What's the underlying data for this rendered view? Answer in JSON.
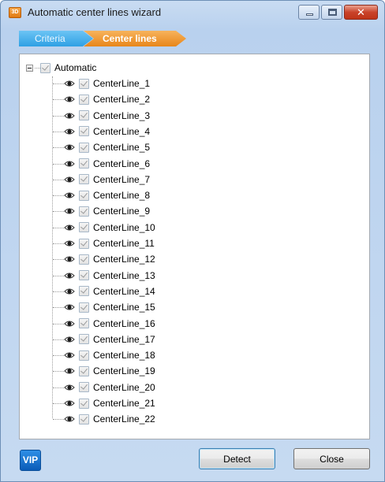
{
  "window": {
    "title": "Automatic center lines wizard",
    "app_icon_text": "3D"
  },
  "breadcrumb": {
    "steps": [
      "Criteria",
      "Center lines"
    ],
    "active_step": "Center lines"
  },
  "tree": {
    "root": {
      "label": "Automatic",
      "checked": true,
      "expanded": true
    },
    "items": [
      "CenterLine_1",
      "CenterLine_2",
      "CenterLine_3",
      "CenterLine_4",
      "CenterLine_5",
      "CenterLine_6",
      "CenterLine_7",
      "CenterLine_8",
      "CenterLine_9",
      "CenterLine_10",
      "CenterLine_11",
      "CenterLine_12",
      "CenterLine_13",
      "CenterLine_14",
      "CenterLine_15",
      "CenterLine_16",
      "CenterLine_17",
      "CenterLine_18",
      "CenterLine_19",
      "CenterLine_20",
      "CenterLine_21",
      "CenterLine_22"
    ]
  },
  "footer": {
    "logo_text": "VIP",
    "detect_label": "Detect",
    "close_label": "Close"
  },
  "colors": {
    "criteria_tab": "#2ea0e4",
    "center_lines_tab": "#e8861a",
    "vip_logo": "#0a5cb8"
  }
}
